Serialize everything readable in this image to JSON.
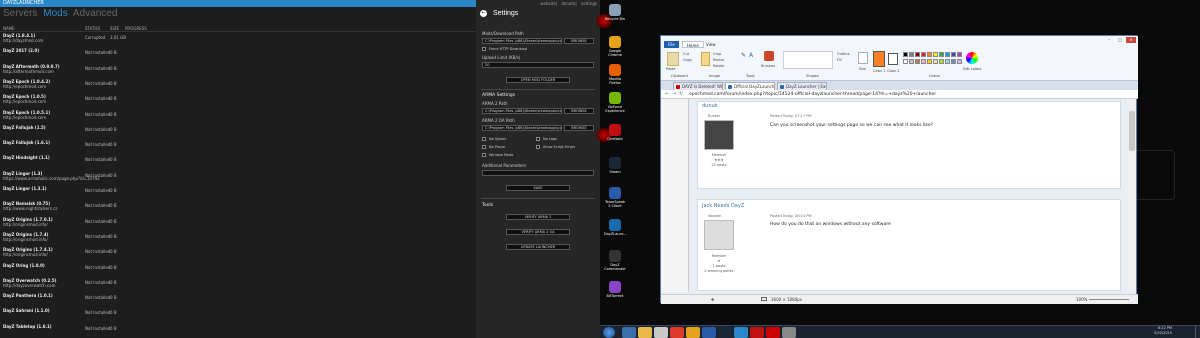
{
  "launcher": {
    "title": "DAYZLAUNCHER",
    "tabs": [
      "Servers",
      "Mods",
      "Advanced"
    ],
    "active_tab": "Mods",
    "columns": [
      "NAME",
      "STATUS",
      "SIZE",
      "PROGRESS"
    ],
    "mods": [
      {
        "name": "DayZ (1.8.4.1)",
        "url": "http://dayzmod.com",
        "status": "Corrupted",
        "size": "3.01 GB"
      },
      {
        "name": "DayZ 2017 (2.0)",
        "url": "",
        "status": "Not Installed",
        "size": "0 B"
      },
      {
        "name": "DayZ Aftermath (0.9.0.7)",
        "url": "http://aftermathmod.com",
        "status": "Not Installed",
        "size": "0 B"
      },
      {
        "name": "DayZ Epoch (1.0.4.2)",
        "url": "http://epochmod.com",
        "status": "Not Installed",
        "size": "0 B"
      },
      {
        "name": "DayZ Epoch (1.0.5)",
        "url": "http://epochmod.com",
        "status": "Not Installed",
        "size": "0 B"
      },
      {
        "name": "DayZ Epoch (1.0.5.1)",
        "url": "http://epochmod.com",
        "status": "Not Installed",
        "size": "0 B"
      },
      {
        "name": "DayZ Fallujah (1.5)",
        "url": "",
        "status": "Not Installed",
        "size": "0 B"
      },
      {
        "name": "DayZ Fallujah (1.6.1)",
        "url": "",
        "status": "Not Installed",
        "size": "0 B"
      },
      {
        "name": "DayZ Hindsight (1.1)",
        "url": "",
        "status": "Not Installed",
        "size": "0 B"
      },
      {
        "name": "DayZ Lingor (1.3)",
        "url": "https://www.armaholic.com/page.php?id=10792",
        "status": "Not Installed",
        "size": "0 B"
      },
      {
        "name": "DayZ Lingor (1.3.1)",
        "url": "",
        "status": "Not Installed",
        "size": "0 B"
      },
      {
        "name": "DayZ Namalsk (0.75)",
        "url": "http://www.nightstalkers.cz",
        "status": "Not Installed",
        "size": "0 B"
      },
      {
        "name": "DayZ Origins (1.7.0.1)",
        "url": "http://originsmod.info/",
        "status": "Not Installed",
        "size": "0 B"
      },
      {
        "name": "DayZ Origins (1.7.4)",
        "url": "http://originsmod.info/",
        "status": "Not Installed",
        "size": "0 B"
      },
      {
        "name": "DayZ Origins (1.7.4.1)",
        "url": "http://originsmod.info/",
        "status": "Not Installed",
        "size": "0 B"
      },
      {
        "name": "DayZ Oring (1.0.0)",
        "url": "",
        "status": "Not Installed",
        "size": "0 B"
      },
      {
        "name": "DayZ Overwatch (0.2.5)",
        "url": "http://dayzoverwatch.com",
        "status": "Not Installed",
        "size": "0 B"
      },
      {
        "name": "DayZ Panthera (1.0.1)",
        "url": "",
        "status": "Not Installed",
        "size": "0 B"
      },
      {
        "name": "DayZ Sahrani (1.1.0)",
        "url": "",
        "status": "Not Installed",
        "size": "0 B"
      },
      {
        "name": "DayZ Tabletop (1.0.1)",
        "url": "",
        "status": "Not Installed",
        "size": "0 B"
      }
    ]
  },
  "settings": {
    "top_links": [
      "website",
      "donate",
      "settings"
    ],
    "heading": "Settings",
    "mods_path_label": "Mods/Download Path",
    "mods_path_value": "C:\\Program Files (x86)\\Steam\\steamapps\\comm",
    "browse_label": "BROWSE",
    "force_http_label": "Force HTTP Download",
    "upload_limit_label": "Upload Limit (KB/s)",
    "upload_limit_value": "20",
    "open_mods_folder_label": "OPEN MOD FOLDER",
    "arma_settings_label": "ARMA Settings",
    "arma2_path_label": "ARMA 2 Path",
    "arma2_path_value": "C:\\Program Files (x86)\\Steam\\steamapps\\comm",
    "arma2oa_path_label": "ARMA 2 OA Path",
    "arma2oa_path_value": "C:\\Program Files (x86)\\Steam\\steamapps\\comm",
    "no_splash_label": "No Splash",
    "no_logs_label": "No Logs",
    "no_pause_label": "No Pause",
    "show_script_errors_label": "Show Script Errors",
    "window_mode_label": "Window Mode",
    "additional_params_label": "Additional Parameters",
    "save_label": "SAVE",
    "tools_label": "Tools",
    "verify_arma2_label": "VERIFY ARMA 2",
    "verify_arma2oa_label": "VERIFY ARMA 2 OA",
    "update_launcher_label": "UPDATE LAUNCHER"
  },
  "desktop": {
    "icons": [
      {
        "label": "Recycle Bin",
        "color": "#8aa0b8"
      },
      {
        "label": "Google Chrome",
        "color": "#e4a11b"
      },
      {
        "label": "Mozilla Firefox",
        "color": "#e66000"
      },
      {
        "label": "GeForce Experience",
        "color": "#76b900"
      },
      {
        "label": "OneNote",
        "color": "#c01010"
      },
      {
        "label": "Steam",
        "color": "#1b2838"
      },
      {
        "label": "TeamSpeak 3 Client",
        "color": "#2a5aa8"
      },
      {
        "label": "DayZLaunc...",
        "color": "#1a6ab0"
      },
      {
        "label": "DayZ Commander",
        "color": "#333333"
      },
      {
        "label": "BitTorrent",
        "color": "#8a44c8"
      }
    ]
  },
  "paint": {
    "tabs": [
      "File",
      "Home",
      "View"
    ],
    "groups": [
      "Clipboard",
      "Image",
      "Tools",
      "Shapes",
      "Colors"
    ],
    "buttons": [
      "Paste",
      "Cut",
      "Copy",
      "Crop",
      "Resize",
      "Rotate",
      "Brushes",
      "Outline",
      "Fill",
      "Size",
      "Color 1",
      "Color 2",
      "Edit colors"
    ],
    "palette": [
      "#000000",
      "#7f7f7f",
      "#880015",
      "#ed1c24",
      "#ff7f27",
      "#fff200",
      "#22b14c",
      "#00a2e8",
      "#3f48cc",
      "#a349a4",
      "#ffffff",
      "#c3c3c3",
      "#b97a57",
      "#ffaec9",
      "#ffc90e",
      "#efe4b0",
      "#b5e61d",
      "#99d9ea",
      "#7092be",
      "#c8bfe7"
    ]
  },
  "browser": {
    "tabs": [
      {
        "label": "DAYZ Is Deleted! Why...",
        "color": "#cc0000"
      },
      {
        "label": "Official DayZLauncher Thr...",
        "color": "#2a6ab0"
      },
      {
        "label": "DayZ Launcher | Easy to...",
        "color": "#2a6ab0"
      }
    ],
    "url": "epochmod.com/forum/index.php?/topic/14524-official-dayzlauncher-thread/page-14?hl=+dayz%20+launcher",
    "posts": [
      {
        "author": "dunuk",
        "role": "Member",
        "rank": "★★★",
        "count": "22 posts",
        "posted": "Posted Today, 07:17 PM",
        "body": "Can you screenshot your settings page so we can see what it looks like?",
        "username_small": "Bunker"
      },
      {
        "author": "Jack Needs DayZ",
        "role": "Member",
        "rank": "★",
        "count": "1 posts",
        "extra": "0 warning points",
        "posted": "Posted Today, 08:14 PM",
        "body": "How do you do that on windows without any software",
        "username_small": "Newbie"
      }
    ],
    "status": {
      "dimensions": "3600 × 1080px",
      "zoom": "100%"
    }
  },
  "taskbar": {
    "apps": [
      "#3a6ea8",
      "#e8b84a",
      "#c8c8c8",
      "#dd3a2a",
      "#e4a11b",
      "#2a5aa8",
      "#1b2838",
      "#2a88c8",
      "#c01010",
      "#cc0000",
      "#888888"
    ],
    "time": "8:22 PM",
    "date": "5/22/2015"
  }
}
